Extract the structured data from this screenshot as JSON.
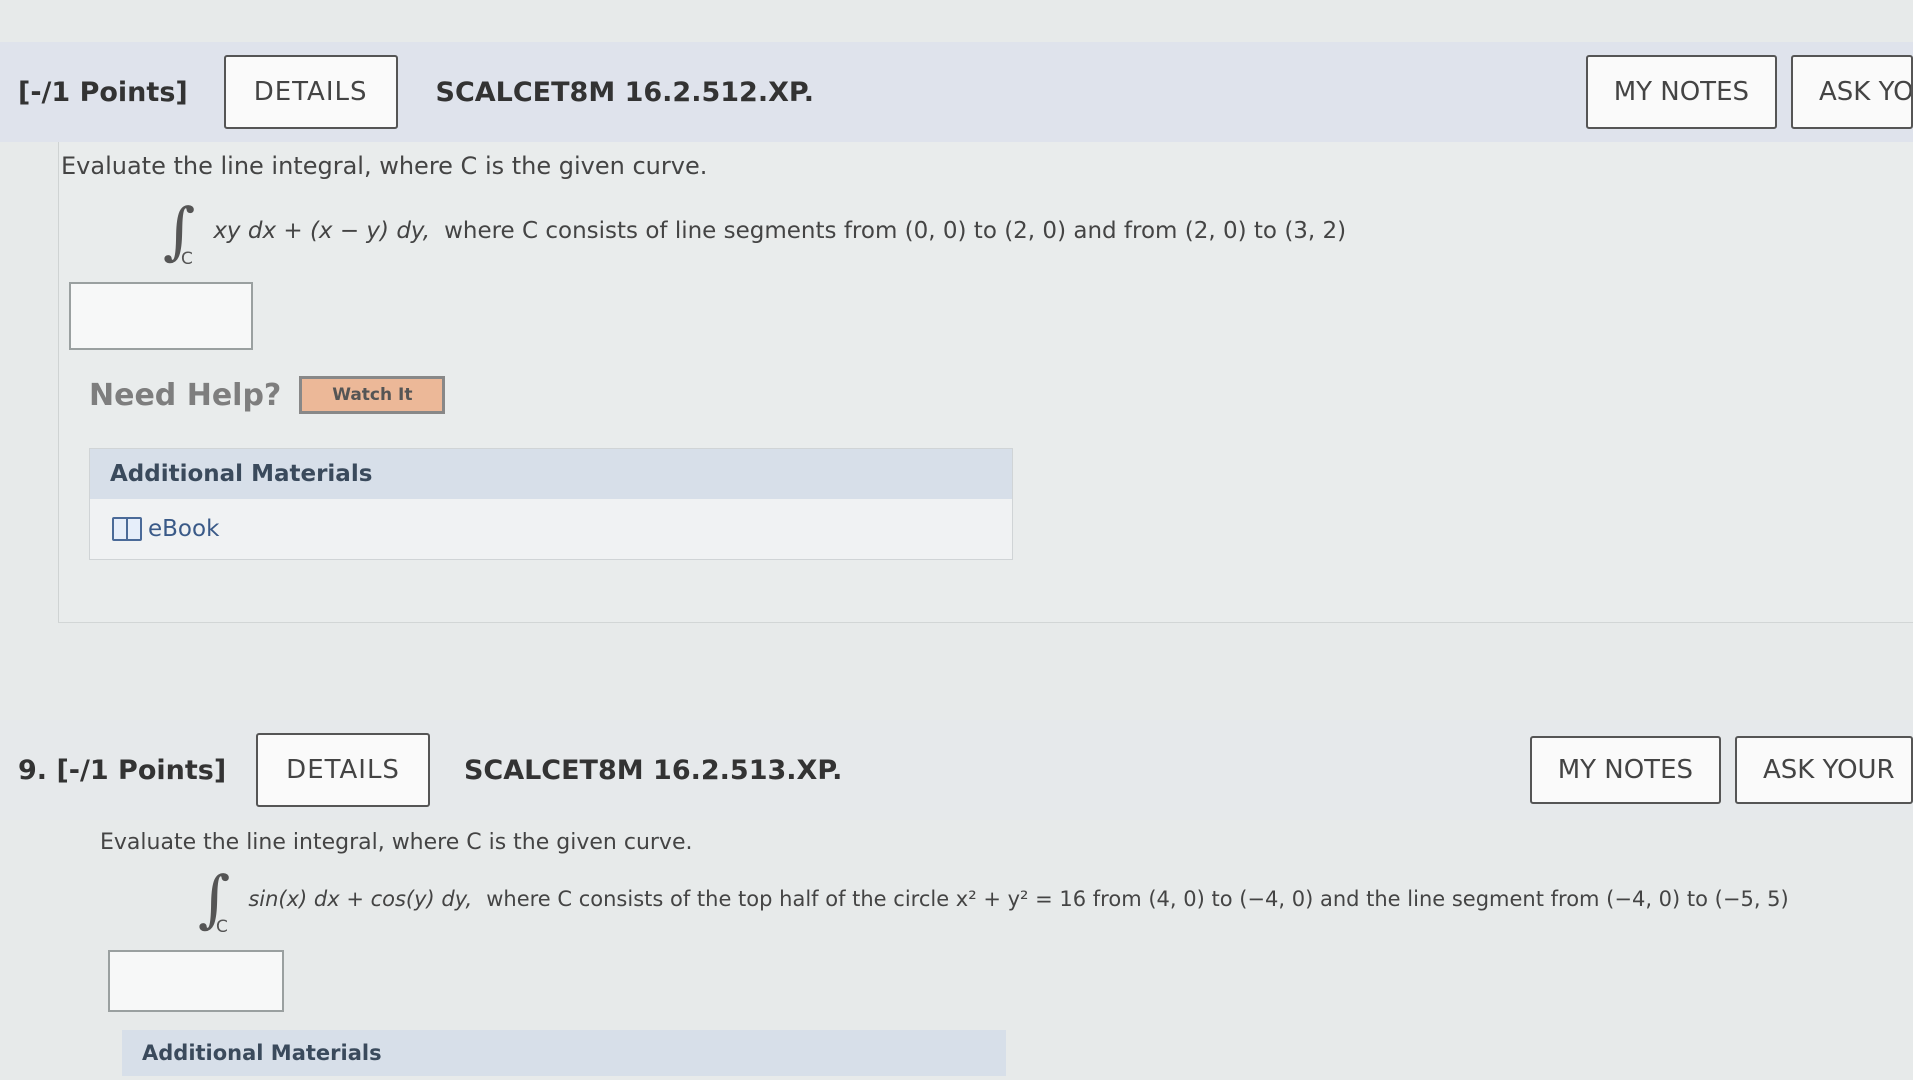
{
  "question1": {
    "points": "[-/1 Points]",
    "details_label": "DETAILS",
    "code": "SCALCET8M 16.2.512.XP.",
    "my_notes_label": "MY NOTES",
    "ask_label": "ASK YO",
    "prompt": "Evaluate the line integral, where C is the given curve.",
    "integral_sub": "C",
    "integrand": "xy dx + (x − y) dy,",
    "curve_desc": "where C consists of line segments from (0, 0) to (2, 0) and from (2, 0) to (3, 2)",
    "answer_value": "",
    "need_help": "Need Help?",
    "watch_label": "Watch It",
    "additional_materials": "Additional Materials",
    "ebook_label": "eBook"
  },
  "question2": {
    "number_points": "9.  [-/1 Points]",
    "details_label": "DETAILS",
    "code": "SCALCET8M 16.2.513.XP.",
    "my_notes_label": "MY NOTES",
    "ask_label": "ASK YOUR",
    "prompt": "Evaluate the line integral, where C is the given curve.",
    "integral_sub": "C",
    "integrand": "sin(x) dx + cos(y) dy,",
    "curve_desc": "where C consists of the top half of the circle  x² + y² = 16 from (4, 0) to (−4, 0)  and the line segment from  (−4, 0) to (−5, 5)",
    "answer_value": "",
    "additional_materials": "Additional Materials"
  },
  "icons": {
    "ebook": "book-icon"
  }
}
